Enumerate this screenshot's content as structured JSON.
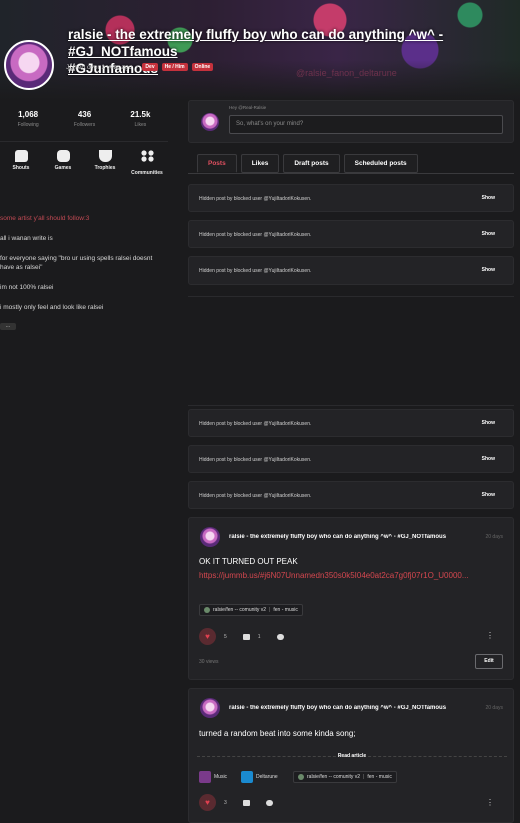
{
  "profile": {
    "display_name": "ralsie - the extremely fluffy boy who can do anything ^w^ - #GJ_NOTfamous",
    "tagline": "#GJunfamous",
    "joined": "Joined over 1 year ago",
    "badges": [
      "Dev",
      "He / Him",
      "Online"
    ],
    "banner_text": "@ralsie_fanon_deltarune"
  },
  "stats": [
    {
      "value": "1,068",
      "label": "Following"
    },
    {
      "value": "436",
      "label": "Followers"
    },
    {
      "value": "21.5k",
      "label": "Likes"
    }
  ],
  "shortcuts": [
    {
      "label": "Shouts",
      "icon": "chat-bubble-icon"
    },
    {
      "label": "Games",
      "icon": "gamepad-icon"
    },
    {
      "label": "Trophies",
      "icon": "trophy-icon"
    },
    {
      "label": "Communities",
      "icon": "communities-grid-icon"
    }
  ],
  "bio": [
    "some artist y'all should follow:3",
    "all i wanan write is",
    "for everyone saying \"bro ur using spells ralsei doesnt have as ralsei\"",
    "im not 100% ralsei",
    "i mostly only feel and look like ralsei"
  ],
  "bio_more": "...",
  "composer": {
    "greeting": "Hey @Real-Ralsie",
    "placeholder": "So, what's on your mind?"
  },
  "tabs": [
    "Posts",
    "Likes",
    "Draft posts",
    "Scheduled posts"
  ],
  "hidden_post": {
    "text": "Hidden post by blocked user @YujiItadoriKokusen.",
    "show_label": "Show"
  },
  "posts": [
    {
      "author": "ralsie - the extremely fluffy boy who can do anything ^w^ - #GJ_NOTfamous",
      "time": "20 days",
      "text": "OK IT TURNED OUT PEAK",
      "link": "https://jummb.us/#j6N07Unnamedn350s0k5I04e0at2ca7g0fj07r1O_U0000...",
      "community": "ralsie/fen -- comunity v2",
      "channel": "fen - music",
      "likes": "5",
      "comments": "1",
      "views": "30 views",
      "edit_label": "Edit"
    },
    {
      "author": "ralsie - the extremely fluffy boy who can do anything ^w^ - #GJ_NOTfamous",
      "time": "20 days",
      "text": "turned a random beat into some kinda song;",
      "read_more": "Read article",
      "categories": [
        "Music",
        "Deltarune"
      ],
      "community": "ralsie/fen -- comunity v2",
      "channel": "fen - music",
      "likes": "3"
    }
  ],
  "colors": {
    "accent": "#e05060",
    "link": "#d4474f",
    "background": "#1b1b1d",
    "card": "#232326"
  }
}
